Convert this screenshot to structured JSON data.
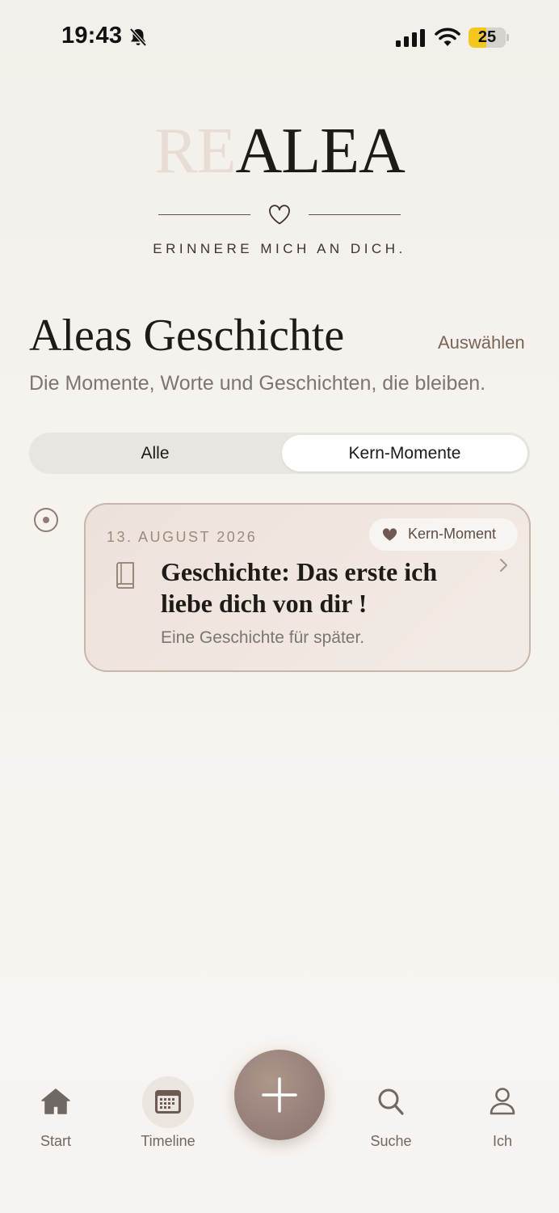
{
  "status_bar": {
    "time": "19:43",
    "battery_level": "25",
    "icons": [
      "bell-slash-icon",
      "cellular-signal-icon",
      "wifi-icon",
      "battery-icon"
    ]
  },
  "brand": {
    "logo_faded": "RE",
    "logo_main": "ALEA",
    "tagline": "ERINNERE MICH AN DICH.",
    "colors": {
      "faded": "#e7ddd5",
      "main": "#1d1a17"
    }
  },
  "header": {
    "title": "Aleas Geschichte",
    "select_label": "Auswählen",
    "subtitle": "Die Momente, Worte und Geschichten, die bleiben."
  },
  "filter": {
    "options": [
      "Alle",
      "Kern-Momente"
    ],
    "selected": "Kern-Momente"
  },
  "entries": [
    {
      "date": "13. AUGUST 2026",
      "badge": "Kern-Moment",
      "title": "Geschichte: Das erste ich liebe dich von dir !",
      "subtitle": "Eine Geschichte für später.",
      "icon": "book-icon"
    }
  ],
  "tabbar": {
    "items": [
      {
        "label": "Start",
        "icon": "home-icon"
      },
      {
        "label": "Timeline",
        "icon": "calendar-icon",
        "active": true
      },
      {
        "label": "Suche",
        "icon": "search-icon"
      },
      {
        "label": "Ich",
        "icon": "person-icon"
      }
    ],
    "add_icon": "plus-icon",
    "accent": "#97807a"
  }
}
